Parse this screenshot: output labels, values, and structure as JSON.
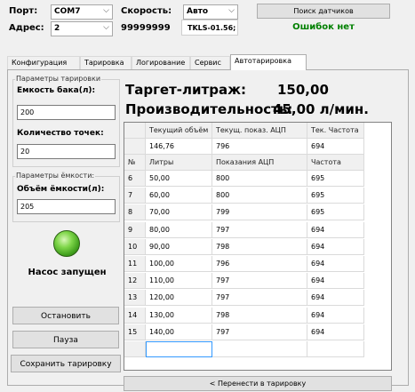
{
  "header": {
    "port_label": "Порт:",
    "port_value": "COM7",
    "address_label": "Адрес:",
    "address_value": "2",
    "speed_label": "Скорость:",
    "speed_value": "Авто",
    "serial_value": "99999999",
    "model_value": "TKLS-01.56;",
    "search_button": "Поиск датчиков",
    "status_text": "Ошибок нет",
    "status_color": "#008000"
  },
  "tabs": [
    {
      "label": "Конфигурация"
    },
    {
      "label": "Тарировка"
    },
    {
      "label": "Логирование"
    },
    {
      "label": "Сервис"
    },
    {
      "label": "Автотарировка"
    }
  ],
  "active_tab": "Автотарировка",
  "left": {
    "calib_group_title": "Параметры тарировки",
    "tank_capacity_label": "Емкость бака(л):",
    "tank_capacity_value": "200",
    "points_label": "Количество точек:",
    "points_value": "20",
    "capacity_group_title": "Параметры ёмкости:",
    "volume_label": "Объём ёмкости(л):",
    "volume_value": "205",
    "pump_status": "Насос запущен",
    "pump_led_color": "#5ec22c",
    "stop_button": "Остановить",
    "pause_button": "Пауза",
    "save_button": "Сохранить тарировку"
  },
  "main": {
    "target_label": "Таргет-литраж:",
    "target_value": "150,00",
    "productivity_label": "Производительность:",
    "productivity_value": "45,00 л/мин."
  },
  "current_table": {
    "headers": [
      "Текущий объём",
      "Текущ. показ. АЦП",
      "Тек. Частота"
    ],
    "values": [
      "146,76",
      "796",
      "694"
    ]
  },
  "points_table": {
    "headers": [
      "№",
      "Литры",
      "Показания АЦП",
      "Частота"
    ],
    "rows": [
      [
        "6",
        "50,00",
        "800",
        "695"
      ],
      [
        "7",
        "60,00",
        "800",
        "695"
      ],
      [
        "8",
        "70,00",
        "799",
        "695"
      ],
      [
        "9",
        "80,00",
        "797",
        "694"
      ],
      [
        "10",
        "90,00",
        "798",
        "694"
      ],
      [
        "11",
        "100,00",
        "796",
        "694"
      ],
      [
        "12",
        "110,00",
        "797",
        "694"
      ],
      [
        "13",
        "120,00",
        "797",
        "694"
      ],
      [
        "14",
        "130,00",
        "798",
        "694"
      ],
      [
        "15",
        "140,00",
        "797",
        "694"
      ]
    ]
  },
  "transfer_button": "< Перенести в тарировку"
}
